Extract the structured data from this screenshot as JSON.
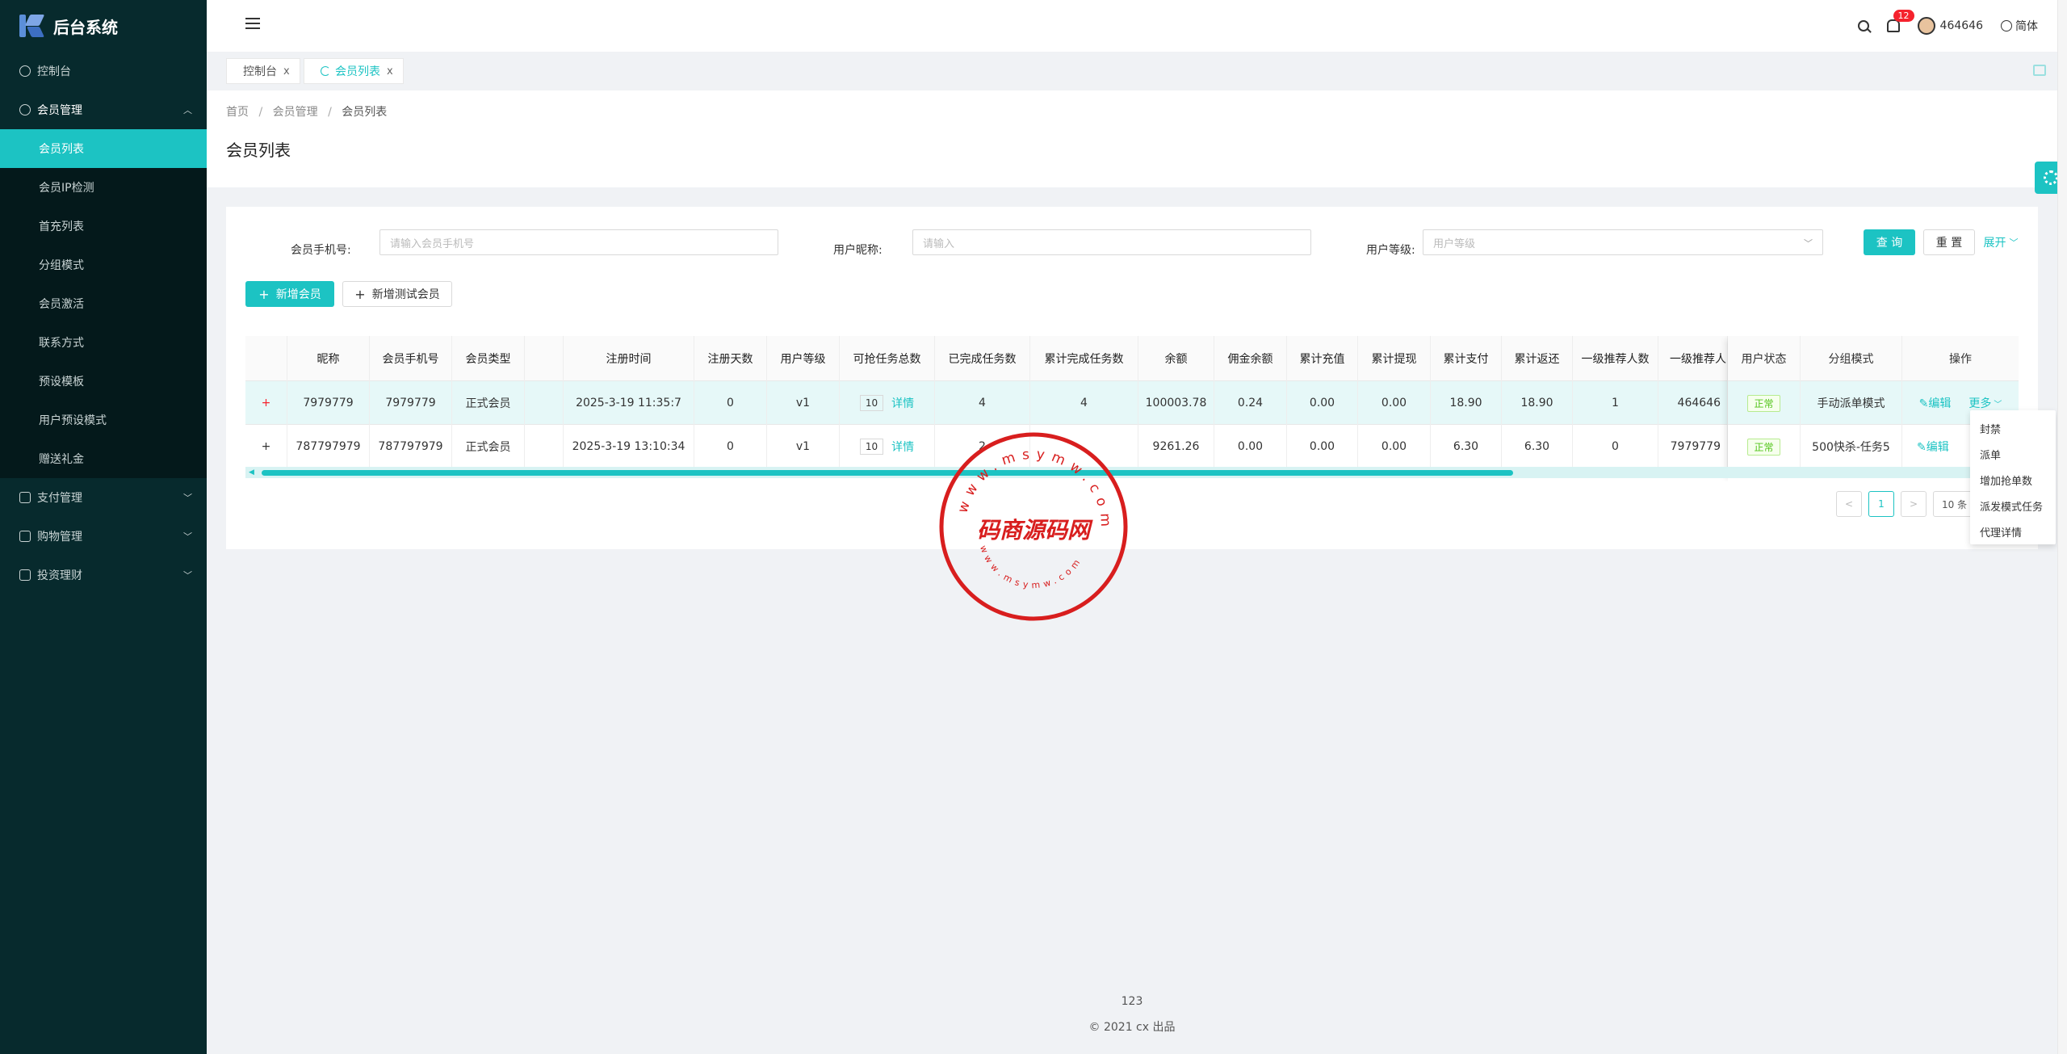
{
  "app": {
    "title": "后台系统"
  },
  "sidebar": {
    "items": [
      {
        "label": "控制台"
      },
      {
        "label": "会员管理",
        "children": [
          "会员列表",
          "会员IP检测",
          "首充列表",
          "分组模式",
          "会员激活",
          "联系方式",
          "预设模板",
          "用户预设模式",
          "赠送礼金"
        ]
      },
      {
        "label": "支付管理"
      },
      {
        "label": "购物管理"
      },
      {
        "label": "投资理财"
      }
    ]
  },
  "header": {
    "notification_count": "12",
    "username": "464646",
    "language": "简体"
  },
  "tabs": [
    {
      "label": "控制台",
      "close": "x"
    },
    {
      "label": "会员列表",
      "close": "x"
    }
  ],
  "breadcrumb": [
    "首页",
    "/",
    "会员管理",
    "/",
    "会员列表"
  ],
  "page_title": "会员列表",
  "filters": {
    "phone_label": "会员手机号:",
    "phone_placeholder": "请输入会员手机号",
    "nickname_label": "用户昵称:",
    "nickname_placeholder": "请输入",
    "level_label": "用户等级:",
    "level_placeholder": "用户等级",
    "search": "查 询",
    "reset": "重 置",
    "expand": "展开"
  },
  "actions": {
    "add_member": "新增会员",
    "add_test_member": "新增测试会员"
  },
  "table": {
    "columns": [
      "",
      "昵称",
      "会员手机号",
      "会员类型",
      "",
      "注册时间",
      "注册天数",
      "用户等级",
      "可抢任务总数",
      "已完成任务数",
      "累计完成任务数",
      "余额",
      "佣金余额",
      "累计充值",
      "累计提现",
      "累计支付",
      "累计返还",
      "一级推荐人数",
      "一级推荐人",
      "用户状态",
      "分组模式",
      "操作"
    ],
    "rows": [
      {
        "expand": "+",
        "nickname": "7979779",
        "phone": "7979779",
        "type": "正式会员",
        "reg_time": "2025-3-19 11:35:7",
        "reg_days": "0",
        "level": "v1",
        "task_total": "10",
        "detail": "详情",
        "done": "4",
        "done_total": "4",
        "balance": "100003.78",
        "commission": "0.24",
        "recharge": "0.00",
        "withdraw": "0.00",
        "pay": "18.90",
        "refund": "18.90",
        "ref_count": "1",
        "referrer": "464646",
        "status": "正常",
        "group": "手动派单模式",
        "edit": "编辑",
        "more": "更多"
      },
      {
        "expand": "+",
        "nickname": "787797979",
        "phone": "787797979",
        "type": "正式会员",
        "reg_time": "2025-3-19 13:10:34",
        "reg_days": "0",
        "level": "v1",
        "task_total": "10",
        "detail": "详情",
        "done": "2",
        "done_total": "",
        "balance": "9261.26",
        "commission": "0.00",
        "recharge": "0.00",
        "withdraw": "0.00",
        "pay": "6.30",
        "refund": "6.30",
        "ref_count": "0",
        "referrer": "7979779",
        "status": "正常",
        "group": "500快杀-任务5",
        "edit": "编辑",
        "more": ""
      }
    ]
  },
  "pagination": {
    "current": "1",
    "size": "10 条"
  },
  "more_menu": [
    "封禁",
    "派单",
    "增加抢单数",
    "派发模式任务",
    "代理详情"
  ],
  "footer": {
    "line1": "123",
    "line2": "© 2021 cx 出品"
  },
  "watermark": {
    "center": "码商源码网",
    "ring": "www.msymw.com"
  },
  "colors": {
    "accent": "#1cc3c3",
    "sidebar": "#072a2d"
  }
}
